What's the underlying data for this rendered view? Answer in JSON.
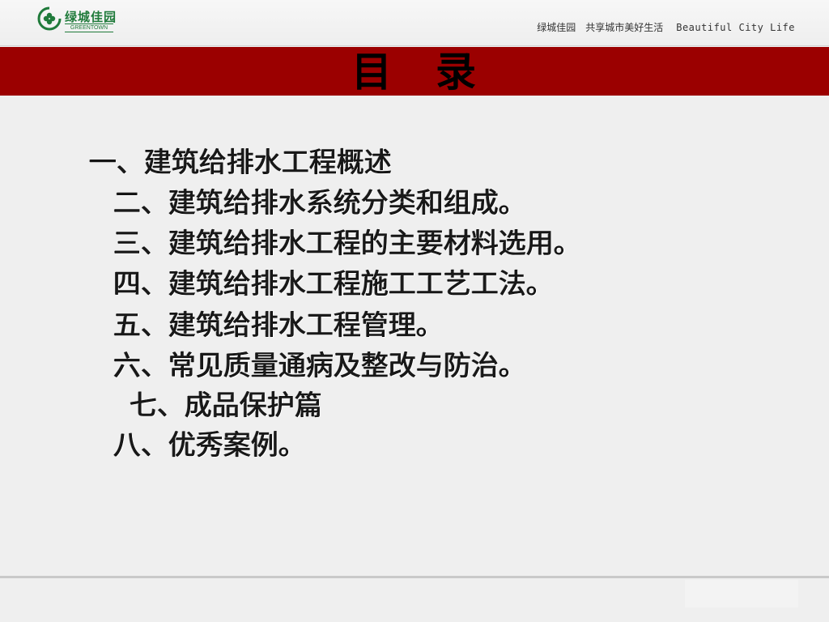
{
  "header": {
    "logo_cn": "绿城佳园",
    "logo_en": "GREENTOWN",
    "tagline_cn": "绿城佳园　共享城市美好生活",
    "tagline_en": "Beautiful City Life"
  },
  "title": "目　录",
  "toc": [
    "一、建筑给排水工程概述",
    "二、建筑给排水系统分类和组成。",
    "三、建筑给排水工程的主要材料选用。",
    "四、建筑给排水工程施工工艺工法。",
    "五、建筑给排水工程管理。",
    "六、常见质量通病及整改与防治。",
    "七、成品保护篇",
    "八、优秀案例。"
  ],
  "colors": {
    "title_band": "#9b0000",
    "brand_green": "#1f7a3a",
    "background": "#efefef"
  }
}
